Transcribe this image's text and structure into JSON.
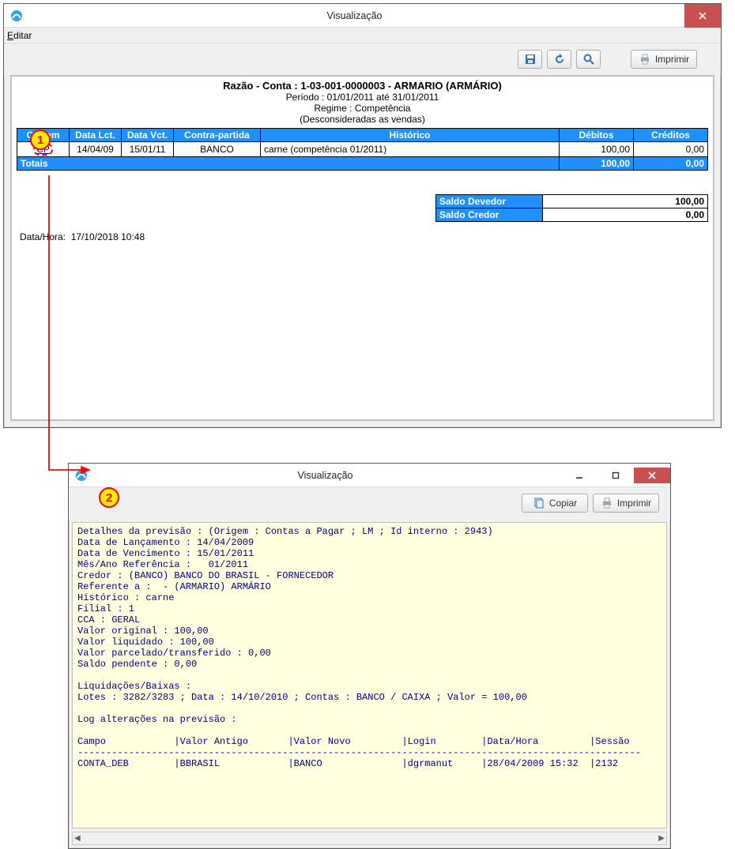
{
  "callouts": {
    "one": "1",
    "two": "2"
  },
  "win1": {
    "title": "Visualização",
    "menu_edit": "Editar",
    "buttons": {
      "print": "Imprimir"
    },
    "report": {
      "title_full": "Razão - Conta : 1-03-001-0000003 - ARMARIO (ARMÁRIO)",
      "periodo": "Período : 01/01/2011 até 31/01/2011",
      "regime": "Regime : Competência",
      "desconsidera": "(Desconsideradas as vendas)",
      "headers": {
        "origem": "Origem",
        "data_lct": "Data Lct.",
        "data_vct": "Data Vct.",
        "contra": "Contra-partida",
        "historico": "Histórico",
        "debitos": "Débitos",
        "creditos": "Créditos"
      },
      "row": {
        "origem": "CP",
        "data_lct": "14/04/09",
        "data_vct": "15/01/11",
        "contra": "BANCO",
        "historico": "carne (competência 01/2011)",
        "debitos": "100,00",
        "creditos": "0,00"
      },
      "totals_label": "Totais",
      "totals_deb": "100,00",
      "totals_cred": "0,00",
      "saldo_dev_label": "Saldo Devedor",
      "saldo_dev": "100,00",
      "saldo_cred_label": "Saldo Credor",
      "saldo_cred": "0,00",
      "datahora_lbl": "Data/Hora:",
      "datahora_val": "17/10/2018 10:48"
    }
  },
  "win2": {
    "title": "Visualização",
    "buttons": {
      "copy": "Copiar",
      "print": "Imprimir"
    },
    "details_text": "Detalhes da previsão : (Origem : Contas a Pagar ; LM ; Id interno : 2943)\nData de Lançamento : 14/04/2009\nData de Vencimento : 15/01/2011\nMês/Ano Referência :   01/2011\nCredor : (BANCO) BANCO DO BRASIL - FORNECEDOR\nReferente a :  - (ARMARIO) ARMÁRIO\nHistórico : carne\nFilial : 1\nCCA : GERAL\nValor original : 100,00\nValor liquidado : 100,00\nValor parcelado/transferido : 0,00\nSaldo pendente : 0,00\n\nLiquidações/Baixas :\nLotes : 3282/3283 ; Data : 14/10/2010 ; Contas : BANCO / CAIXA ; Valor = 100,00\n\nLog alterações na previsão :\n\nCampo            |Valor Antigo       |Valor Novo         |Login        |Data/Hora         |Sessão\n---------------------------------------------------------------------------------------------------\nCONTA_DEB        |BBRASIL            |BANCO              |dgrmanut     |28/04/2009 15:32  |2132\n\n"
  }
}
